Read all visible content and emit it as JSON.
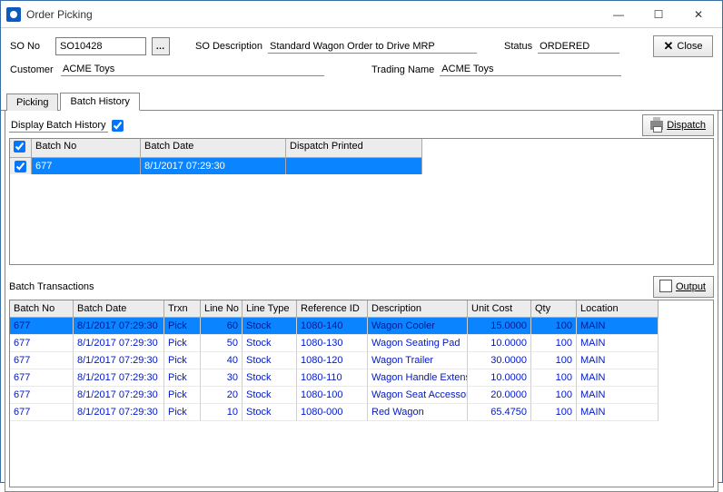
{
  "window": {
    "title": "Order Picking",
    "min": "—",
    "max": "☐",
    "close": "✕"
  },
  "header": {
    "so_no_label": "SO No",
    "so_no_value": "SO10428",
    "so_lookup": "…",
    "so_desc_label": "SO Description",
    "so_desc_value": "Standard Wagon Order to Drive MRP",
    "status_label": "Status",
    "status_value": "ORDERED",
    "close_btn": "Close",
    "customer_label": "Customer",
    "customer_value": "ACME Toys",
    "trading_label": "Trading Name",
    "trading_value": "ACME Toys"
  },
  "tabs": {
    "picking": "Picking",
    "batch_history": "Batch History"
  },
  "panel": {
    "display_batch_history_label": "Display Batch History",
    "dispatch_btn": "Dispatch",
    "batch_transactions_label": "Batch Transactions",
    "output_btn": "Output"
  },
  "batch_grid": {
    "columns": {
      "check": "",
      "batch_no": "Batch No",
      "batch_date": "Batch Date",
      "dispatch_printed": "Dispatch Printed"
    },
    "rows": [
      {
        "checked": true,
        "batch_no": "677",
        "batch_date": "8/1/2017 07:29:30",
        "dispatch_printed": ""
      }
    ]
  },
  "tx_grid": {
    "columns": {
      "batch_no": "Batch No",
      "batch_date": "Batch Date",
      "trxn": "Trxn",
      "line_no": "Line No",
      "line_type": "Line Type",
      "reference_id": "Reference ID",
      "description": "Description",
      "unit_cost": "Unit Cost",
      "qty": "Qty",
      "location": "Location"
    },
    "rows": [
      {
        "batch_no": "677",
        "batch_date": "8/1/2017 07:29:30",
        "trxn": "Pick",
        "line_no": "60",
        "line_type": "Stock",
        "reference_id": "1080-140",
        "description": "Wagon Cooler",
        "unit_cost": "15.0000",
        "qty": "100",
        "location": "MAIN"
      },
      {
        "batch_no": "677",
        "batch_date": "8/1/2017 07:29:30",
        "trxn": "Pick",
        "line_no": "50",
        "line_type": "Stock",
        "reference_id": "1080-130",
        "description": "Wagon Seating Pad",
        "unit_cost": "10.0000",
        "qty": "100",
        "location": "MAIN"
      },
      {
        "batch_no": "677",
        "batch_date": "8/1/2017 07:29:30",
        "trxn": "Pick",
        "line_no": "40",
        "line_type": "Stock",
        "reference_id": "1080-120",
        "description": "Wagon Trailer",
        "unit_cost": "30.0000",
        "qty": "100",
        "location": "MAIN"
      },
      {
        "batch_no": "677",
        "batch_date": "8/1/2017 07:29:30",
        "trxn": "Pick",
        "line_no": "30",
        "line_type": "Stock",
        "reference_id": "1080-110",
        "description": "Wagon Handle Extension",
        "unit_cost": "10.0000",
        "qty": "100",
        "location": "MAIN"
      },
      {
        "batch_no": "677",
        "batch_date": "8/1/2017 07:29:30",
        "trxn": "Pick",
        "line_no": "20",
        "line_type": "Stock",
        "reference_id": "1080-100",
        "description": "Wagon Seat Accessory",
        "unit_cost": "20.0000",
        "qty": "100",
        "location": "MAIN"
      },
      {
        "batch_no": "677",
        "batch_date": "8/1/2017 07:29:30",
        "trxn": "Pick",
        "line_no": "10",
        "line_type": "Stock",
        "reference_id": "1080-000",
        "description": "Red Wagon",
        "unit_cost": "65.4750",
        "qty": "100",
        "location": "MAIN"
      }
    ]
  }
}
